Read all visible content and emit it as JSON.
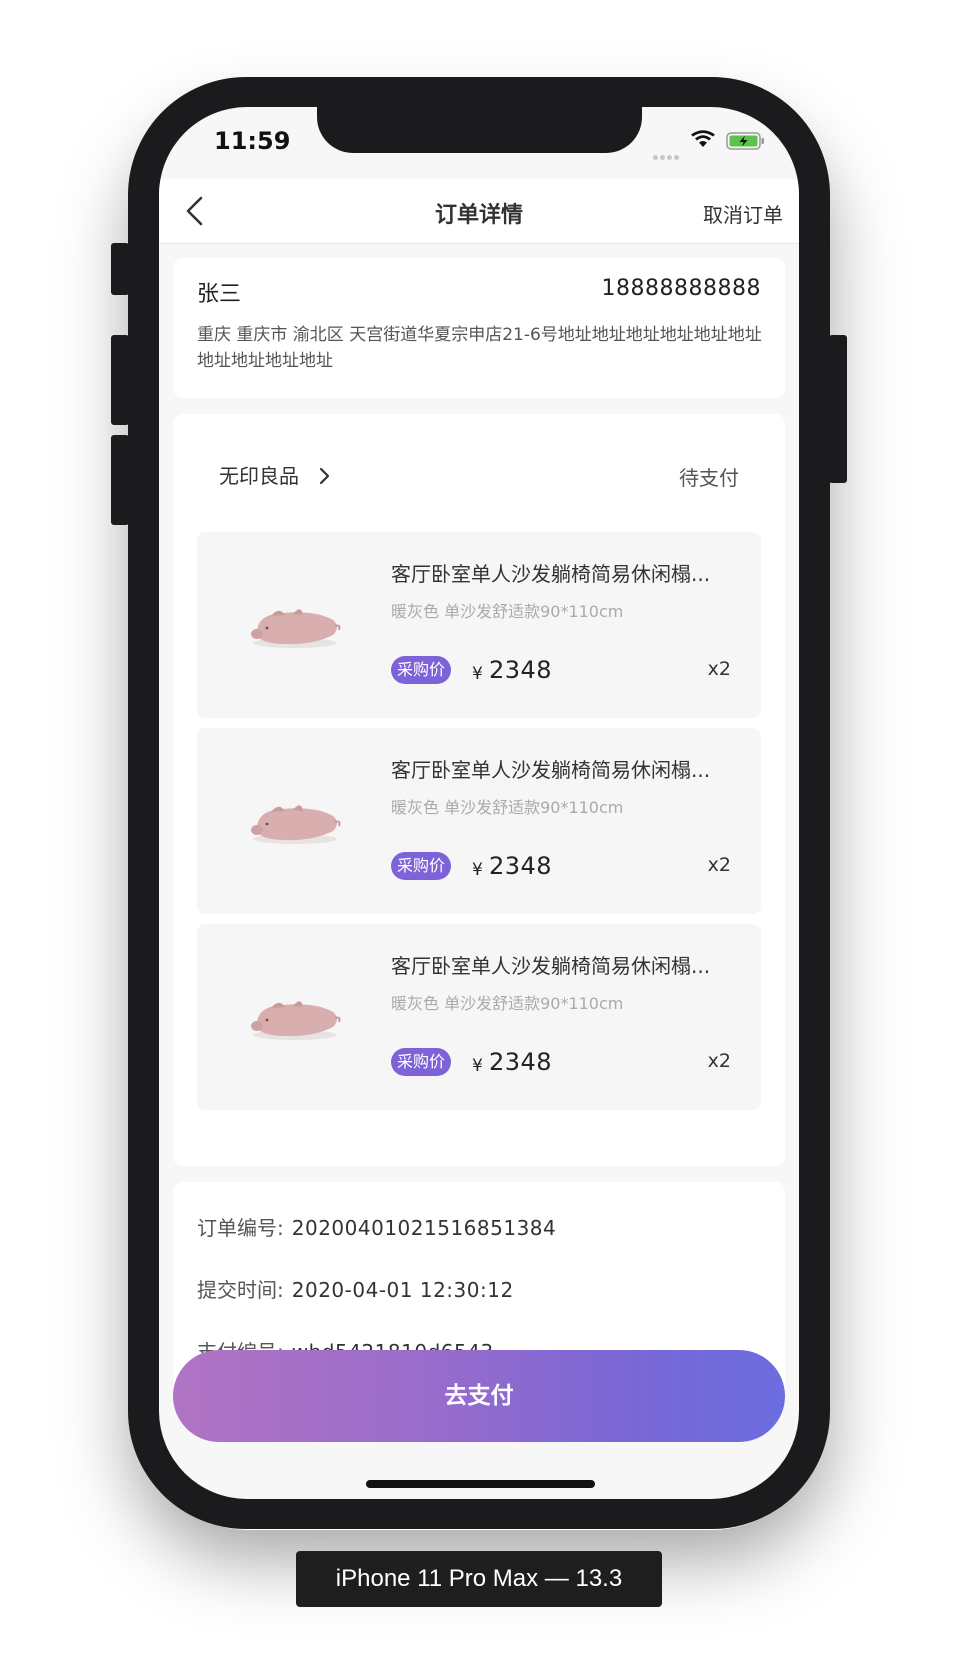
{
  "status_bar": {
    "time": "11:59"
  },
  "navbar": {
    "title": "订单详情",
    "cancel_label": "取消订单"
  },
  "address": {
    "name": "张三",
    "phone": "18888888888",
    "detail": "重庆  重庆市 渝北区 天宫街道华夏宗申店21-6号地址地址地址地址地址地址地址地址地址地址"
  },
  "order": {
    "store_name": "无印良品",
    "status": "待支付",
    "items": [
      {
        "title": "客厅卧室单人沙发躺椅简易休闲榻...",
        "spec": "暖灰色 单沙发舒适款90*110cm",
        "price_label": "采购价",
        "currency": "¥",
        "price": "2348",
        "qty": "x2"
      },
      {
        "title": "客厅卧室单人沙发躺椅简易休闲榻...",
        "spec": "暖灰色 单沙发舒适款90*110cm",
        "price_label": "采购价",
        "currency": "¥",
        "price": "2348",
        "qty": "x2"
      },
      {
        "title": "客厅卧室单人沙发躺椅简易休闲榻...",
        "spec": "暖灰色 单沙发舒适款90*110cm",
        "price_label": "采购价",
        "currency": "¥",
        "price": "2348",
        "qty": "x2"
      }
    ]
  },
  "info": {
    "order_no_label": "订单编号:",
    "order_no": "20200401021516851384",
    "submit_time_label": "提交时间:",
    "submit_time": "2020-04-01 12:30:12",
    "pay_no_label": "支付编号:",
    "pay_no": "wbd5421810d6543"
  },
  "pay_button_label": "去支付",
  "device_label": "iPhone 11 Pro Max — 13.3",
  "colors": {
    "accent_purple": "#7d62d8",
    "gradient_start": "#b174c4",
    "gradient_end": "#6b6ddf"
  },
  "icons": [
    "back-icon",
    "chevron-right-icon",
    "wifi-icon",
    "battery-icon",
    "product-image"
  ]
}
